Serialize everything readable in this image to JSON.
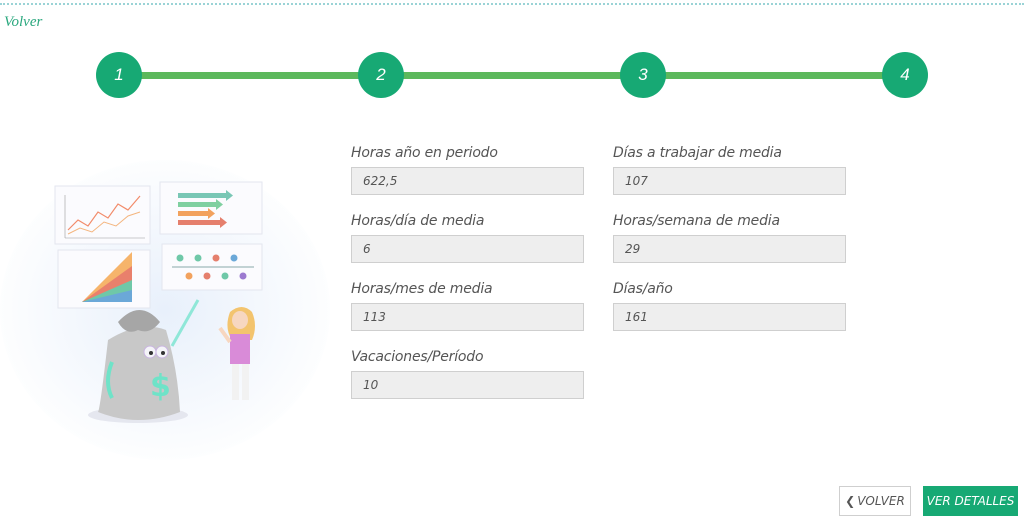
{
  "nav": {
    "back_link": "Volver"
  },
  "stepper": {
    "steps": [
      "1",
      "2",
      "3",
      "4"
    ]
  },
  "form": {
    "horas_anio_periodo": {
      "label": "Horas año en periodo",
      "value": "622,5"
    },
    "dias_trabajar_media": {
      "label": "Días a trabajar de media",
      "value": "107"
    },
    "horas_dia_media": {
      "label": "Horas/día de media",
      "value": "6"
    },
    "horas_semana_media": {
      "label": "Horas/semana de media",
      "value": "29"
    },
    "horas_mes_media": {
      "label": "Horas/mes de media",
      "value": "113"
    },
    "dias_anio": {
      "label": "Días/año",
      "value": "161"
    },
    "vacaciones_periodo": {
      "label": "Vacaciones/Período",
      "value": "10"
    }
  },
  "actions": {
    "volver_label": "VOLVER",
    "detalles_label": "VER DETALLES"
  },
  "colors": {
    "accent": "#17a974",
    "step_line": "#5cb85c",
    "link": "#2aa87e"
  },
  "icons": {
    "back_chevron": "chevron-left-icon"
  }
}
